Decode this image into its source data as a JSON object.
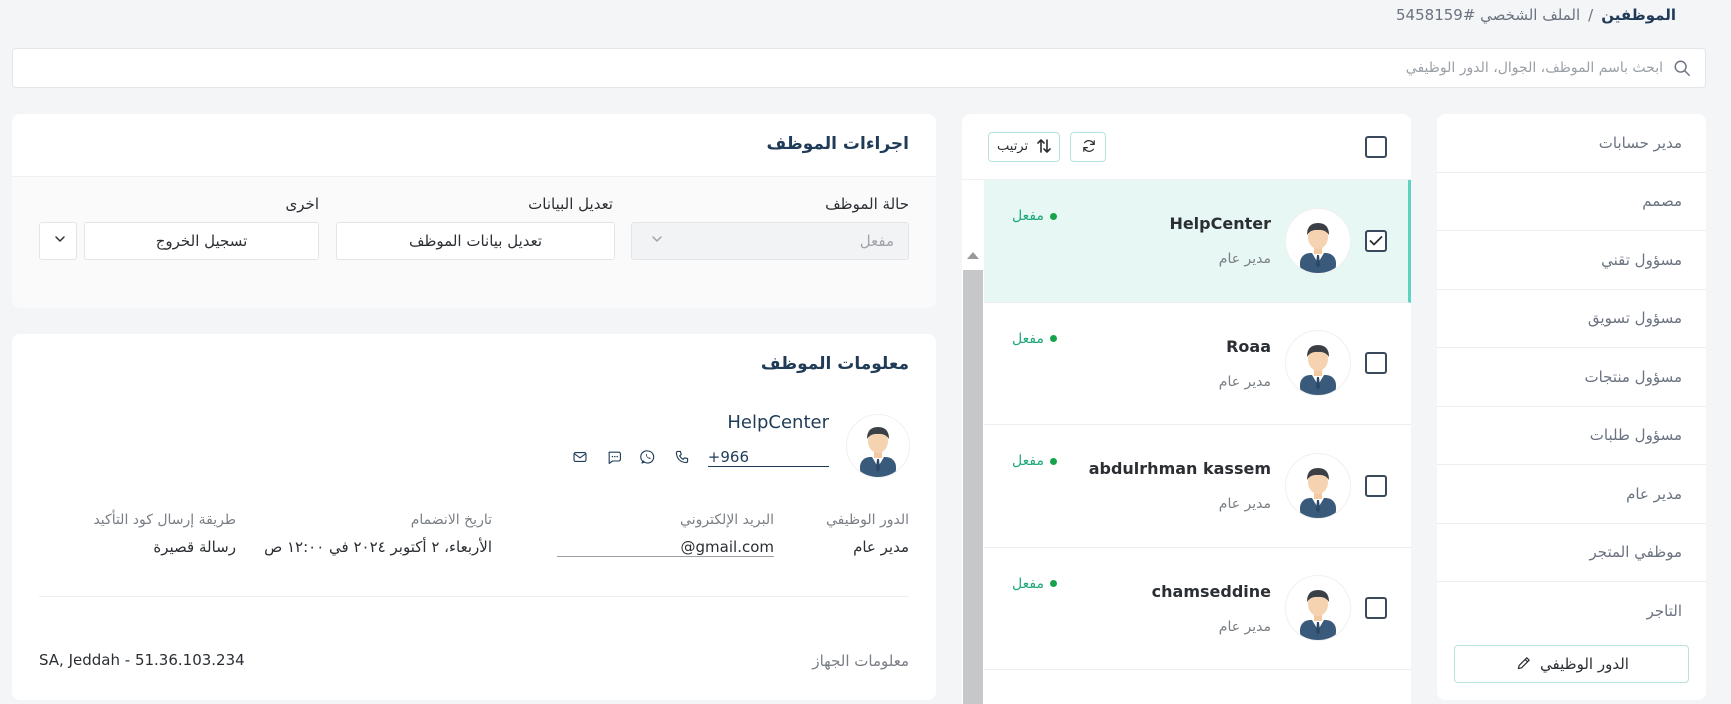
{
  "breadcrumb": {
    "root": "الموظفين",
    "separator": "/",
    "current": "الملف الشخصي #5458159"
  },
  "search": {
    "placeholder": "ابحث باسم الموظف، الجوال، الدور الوظيفي",
    "value": ""
  },
  "roles": {
    "items": [
      "مدير حسابات",
      "مصمم",
      "مسؤول تقني",
      "مسؤول تسويق",
      "مسؤول منتجات",
      "مسؤول طلبات",
      "مدير عام",
      "موظفي المتجر",
      "التاجر"
    ],
    "button_label": "الدور الوظيفي"
  },
  "employee_list": {
    "sort_label": "ترتيب",
    "rows": [
      {
        "name": "HelpCenter",
        "role": "مدير عام",
        "status": "مفعل",
        "checked": true,
        "active": true
      },
      {
        "name": "Roaa",
        "role": "مدير عام",
        "status": "مفعل",
        "checked": false,
        "active": false
      },
      {
        "name": "abdulrhman kassem",
        "role": "مدير عام",
        "status": "مفعل",
        "checked": false,
        "active": false
      },
      {
        "name": "chamseddine",
        "role": "مدير عام",
        "status": "مفعل",
        "checked": false,
        "active": false
      }
    ]
  },
  "actions": {
    "title": "اجراءات الموظف",
    "status_label": "حالة الموظف",
    "status_value": "مفعل",
    "edit_label": "تعديل البيانات",
    "edit_button": "تعديل بيانات الموظف",
    "other_label": "اخرى",
    "other_value": "تسجيل الخروج"
  },
  "info": {
    "title": "معلومات الموظف",
    "name": "HelpCenter",
    "phone": "+966",
    "role_label": "الدور الوظيفي",
    "role_value": "مدير عام",
    "email_label": "البريد الإلكتروني",
    "email_value": "@gmail.com",
    "join_label": "تاريخ الانضمام",
    "join_value": "الأربعاء، ٢ أكتوبر ٢٠٢٤ في ١٢:٠٠ ص",
    "otp_label": "طريقة إرسال كود التأكيد",
    "otp_value": "رسالة قصيرة",
    "device_label": "معلومات الجهاز",
    "device_value": "SA, Jeddah - 51.36.103.234"
  },
  "colors": {
    "accent": "#5fd3c3",
    "active_row_bg": "#e6f7f4",
    "status_green": "#16a34a",
    "title_navy": "#1f3b57"
  }
}
